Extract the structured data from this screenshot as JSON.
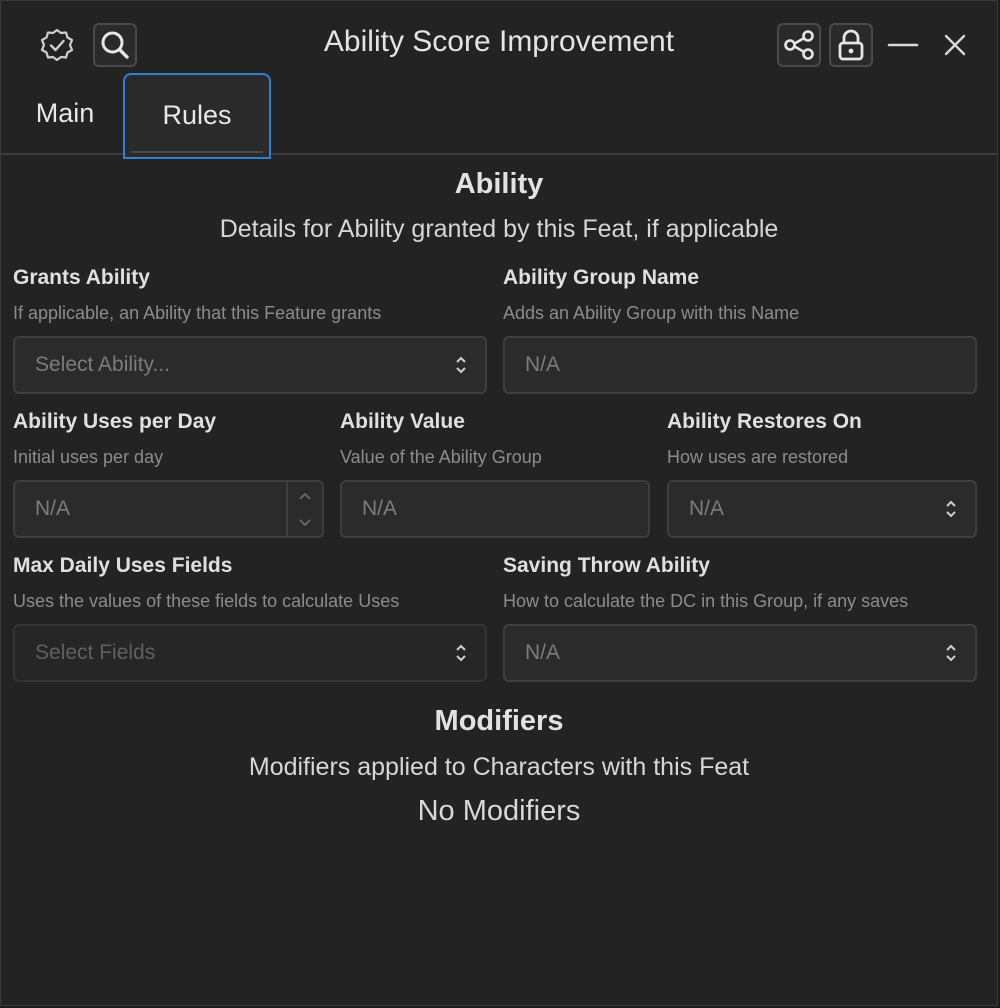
{
  "window": {
    "title": "Ability Score Improvement",
    "icons": {
      "verified": "verified-badge-icon",
      "search": "search-icon",
      "share": "share-icon",
      "lock": "lock-icon",
      "minimize": "minimize-icon",
      "close": "close-icon"
    }
  },
  "tabs": [
    {
      "label": "Main",
      "active": false
    },
    {
      "label": "Rules",
      "active": true
    }
  ],
  "ability": {
    "title": "Ability",
    "description": "Details for Ability granted by this Feat, if applicable",
    "fields": {
      "grants_ability": {
        "label": "Grants Ability",
        "hint": "If applicable, an Ability that this Feature grants",
        "placeholder": "Select Ability..."
      },
      "ability_group_name": {
        "label": "Ability Group Name",
        "hint": "Adds an Ability Group with this Name",
        "placeholder": "N/A"
      },
      "uses_per_day": {
        "label": "Ability Uses per Day",
        "hint": "Initial uses per day",
        "placeholder": "N/A"
      },
      "ability_value": {
        "label": "Ability Value",
        "hint": "Value of the Ability Group",
        "placeholder": "N/A"
      },
      "restores_on": {
        "label": "Ability Restores On",
        "hint": "How uses are restored",
        "placeholder": "N/A"
      },
      "max_daily_uses": {
        "label": "Max Daily Uses Fields",
        "hint": "Uses the values of these fields to calculate Uses",
        "placeholder": "Select Fields"
      },
      "saving_throw": {
        "label": "Saving Throw Ability",
        "hint": "How to calculate the DC in this Group, if any saves",
        "placeholder": "N/A"
      }
    }
  },
  "modifiers": {
    "title": "Modifiers",
    "description": "Modifiers applied to Characters with this Feat",
    "empty_text": "No Modifiers"
  },
  "colors": {
    "background": "#232323",
    "accent": "#2f7fd1"
  }
}
